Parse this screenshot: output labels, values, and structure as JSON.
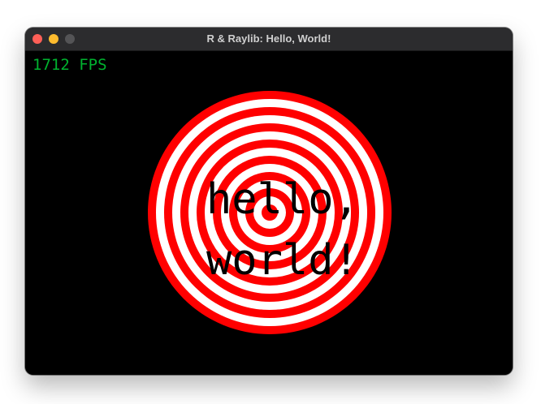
{
  "window": {
    "title": "R & Raylib: Hello, World!",
    "controls": [
      "close-button",
      "minimize-button",
      "zoom-button"
    ]
  },
  "canvas": {
    "background_color": "#000000",
    "fps_text": "1712 FPS",
    "fps_color": "#00b32f",
    "greeting_line1": "hello,",
    "greeting_line2": "world!",
    "greeting_color": "#000000",
    "target": {
      "ring_count": 15,
      "colors": [
        "#ff0000",
        "#ffffff"
      ]
    }
  }
}
